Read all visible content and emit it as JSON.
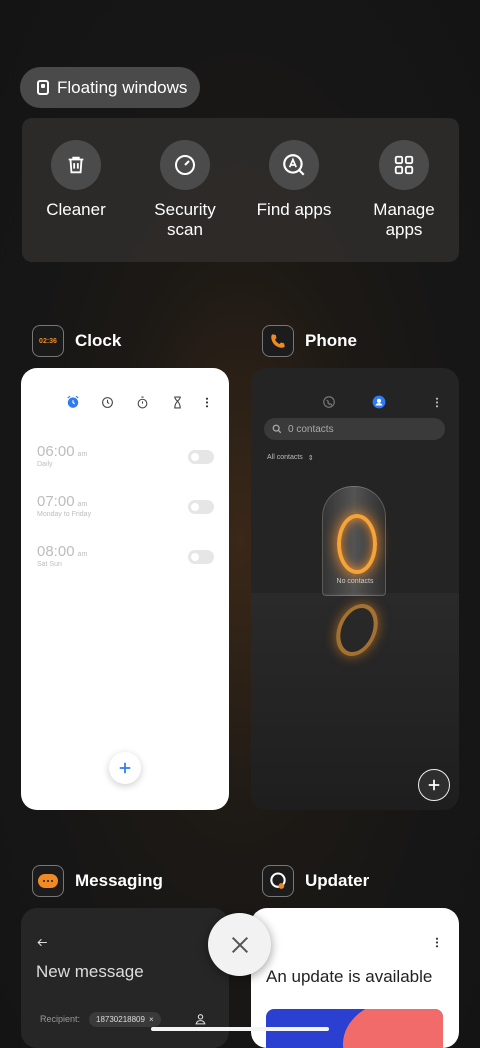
{
  "floating_windows": {
    "label": "Floating windows"
  },
  "tools": [
    {
      "label": "Cleaner",
      "icon": "trash-icon"
    },
    {
      "label": "Security\nscan",
      "icon": "security-scan-icon"
    },
    {
      "label": "Find apps",
      "icon": "find-apps-icon"
    },
    {
      "label": "Manage\napps",
      "icon": "grid-icon"
    }
  ],
  "apps": {
    "clock": {
      "name": "Clock",
      "icon_text": "02:36",
      "alarms": [
        {
          "time": "06:00",
          "ampm": "am",
          "repeat": "Daily"
        },
        {
          "time": "07:00",
          "ampm": "am",
          "repeat": "Monday to Friday"
        },
        {
          "time": "08:00",
          "ampm": "am",
          "repeat": "Sat Sun"
        }
      ]
    },
    "phone": {
      "name": "Phone",
      "search_placeholder": "0 contacts",
      "filter": "All contacts",
      "empty_text": "No contacts"
    },
    "messaging": {
      "name": "Messaging",
      "title": "New message",
      "recipient_label": "Recipient:",
      "recipient_value": "18730218809"
    },
    "updater": {
      "name": "Updater",
      "title": "An update is available"
    }
  },
  "colors": {
    "accent_blue": "#2f7bf5",
    "orange": "#f08a24",
    "clock_card": "#ffffff"
  }
}
